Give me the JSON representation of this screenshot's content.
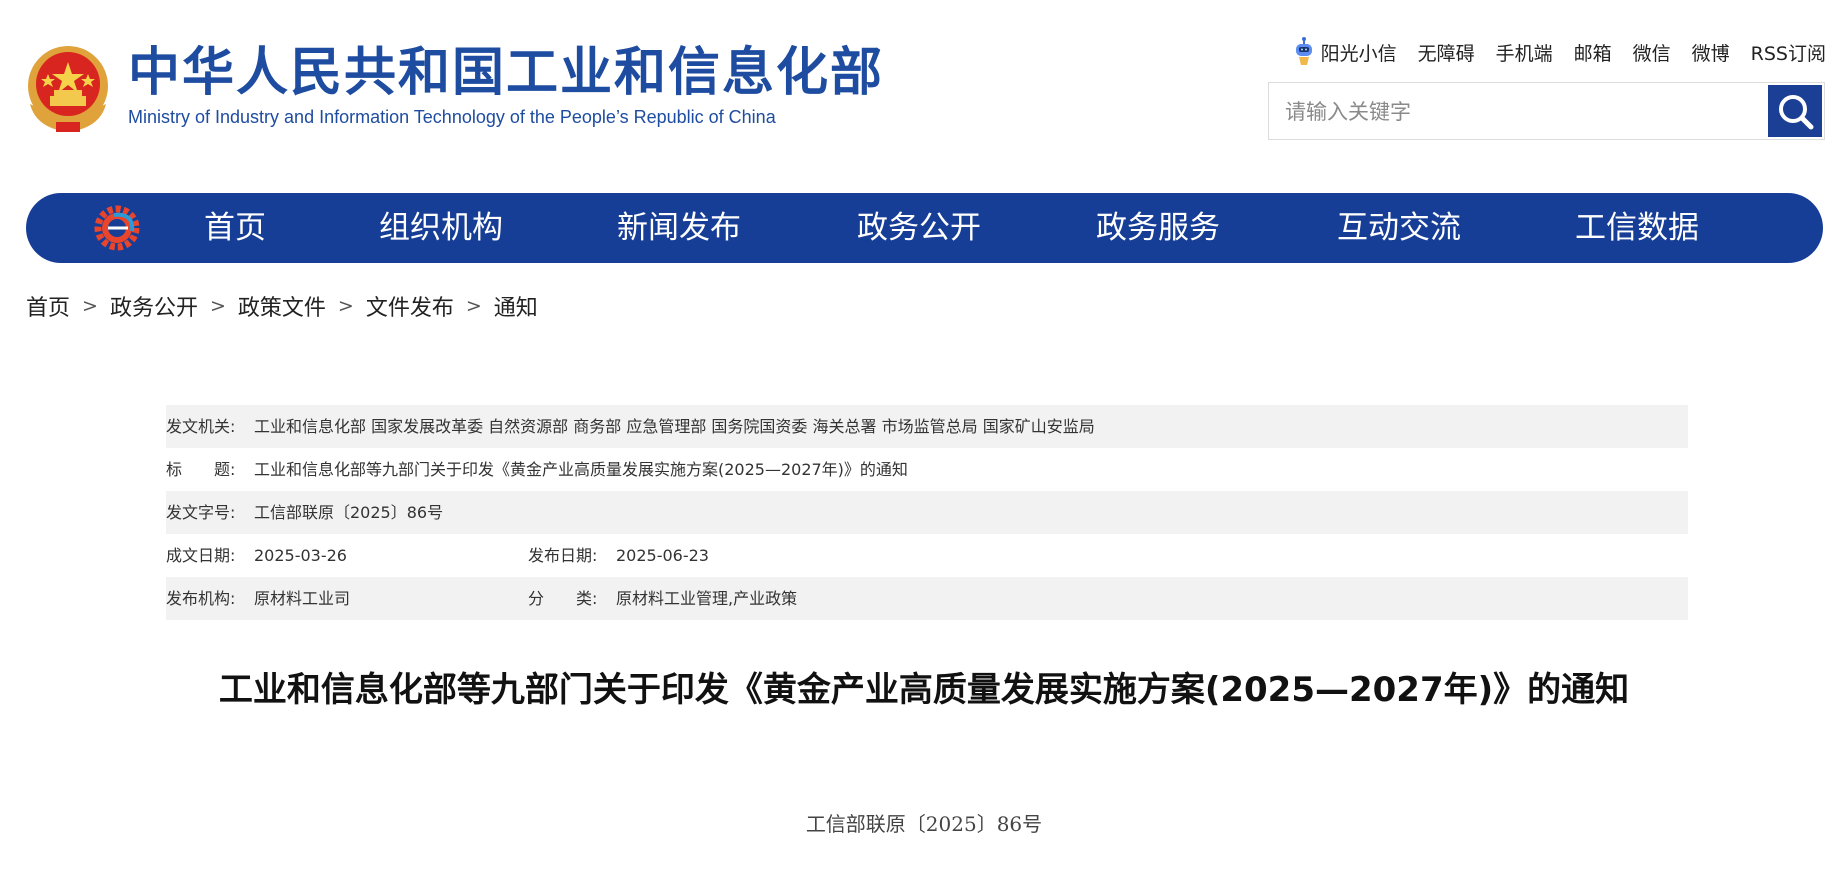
{
  "header": {
    "site_name_cn": "中华人民共和国工业和信息化部",
    "site_name_en": "Ministry of Industry and Information Technology of the People’s Republic of China",
    "top_links": [
      "阳光小信",
      "无障碍",
      "手机端",
      "邮箱",
      "微信",
      "微博",
      "RSS订阅"
    ],
    "search": {
      "placeholder": "请输入关键字",
      "value": ""
    }
  },
  "colors": {
    "brand_blue": "#173e96",
    "title_blue": "#1e4ca0",
    "row_shade": "#f2f2f2"
  },
  "nav": {
    "items": [
      "首页",
      "组织机构",
      "新闻发布",
      "政务公开",
      "政务服务",
      "互动交流",
      "工信数据"
    ]
  },
  "breadcrumb": {
    "items": [
      "首页",
      "政务公开",
      "政策文件",
      "文件发布",
      "通知"
    ],
    "separator": ">"
  },
  "meta": {
    "issuer_label": "发文机关:",
    "issuer": "工业和信息化部 国家发展改革委 自然资源部 商务部 应急管理部 国务院国资委 海关总署 市场监管总局 国家矿山安监局",
    "title_label": "标　　题:",
    "title": "工业和信息化部等九部门关于印发《黄金产业高质量发展实施方案(2025—2027年)》的通知",
    "doc_no_label": "发文字号:",
    "doc_no": "工信部联原〔2025〕86号",
    "written_date_label": "成文日期:",
    "written_date": "2025-03-26",
    "publish_date_label": "发布日期:",
    "publish_date": "2025-06-23",
    "org_label": "发布机构:",
    "org": "原材料工业司",
    "category_label": "分　　类:",
    "category": "原材料工业管理,产业政策"
  },
  "document": {
    "title": "工业和信息化部等九部门关于印发《黄金产业高质量发展实施方案(2025—2027年)》的通知",
    "number": "工信部联原〔2025〕86号"
  }
}
